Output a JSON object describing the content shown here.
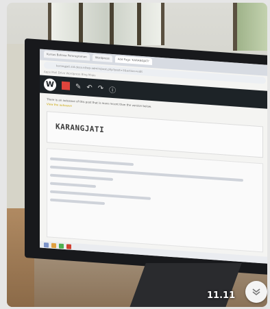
{
  "screen": {
    "tabs": [
      "Kursus Bahasa Pemrograman",
      "Wordpress",
      "Add Page 'KARANGJATI'"
    ],
    "url": "karangjati.sid.desa.id/wp-admin/post.php?post=1&action=edit",
    "bookmarks": "Apps  Mail  Drive  Wordpress  Blog  Maps",
    "notice": "There is an autosave of this post that is more recent than the version below.",
    "notice_link": "View the autosave",
    "page_title": "KARANGJATI"
  },
  "timestamp": "11.11",
  "icons": {
    "wordpress": "wordpress-logo-icon",
    "scroll_down": "double-chevron-down-icon"
  }
}
